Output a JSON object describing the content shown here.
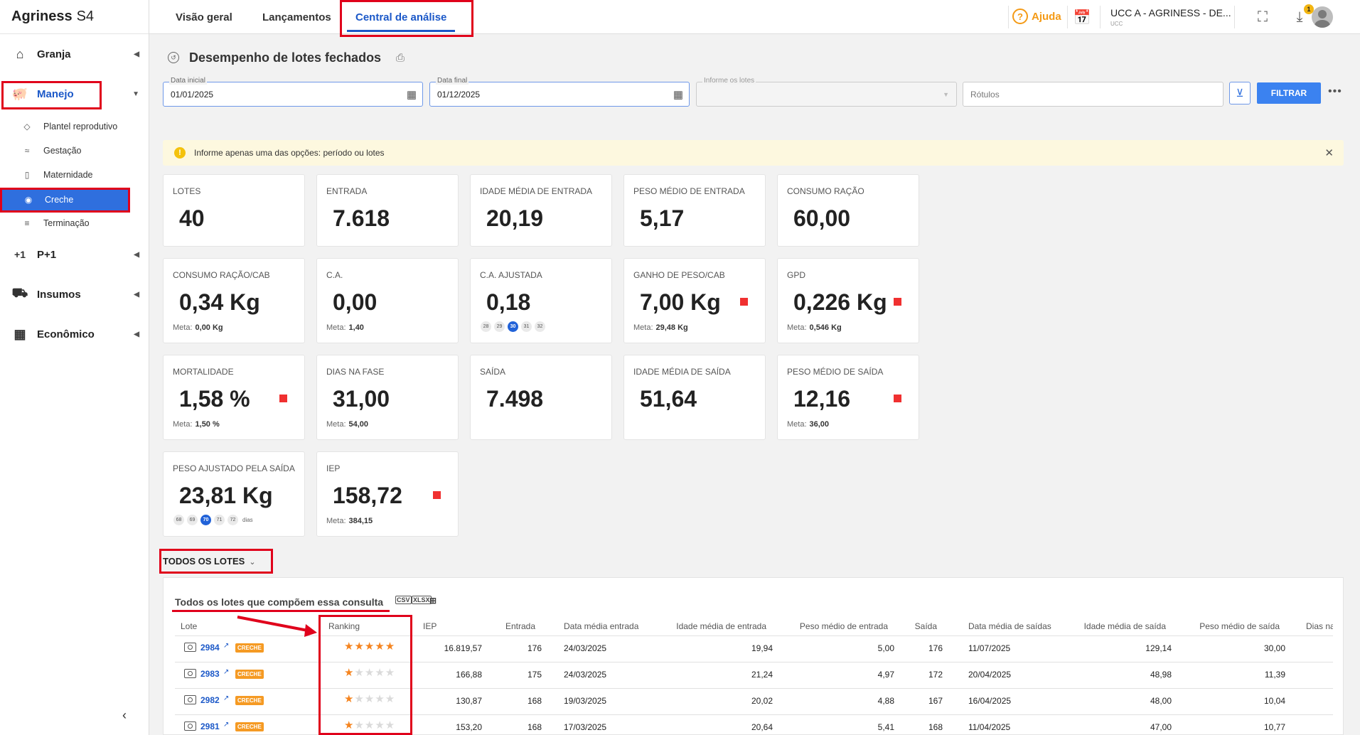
{
  "app": {
    "brand_bold": "Agriness",
    "brand_rest": "S4"
  },
  "tabs": [
    {
      "label": "Visão geral"
    },
    {
      "label": "Lançamentos"
    },
    {
      "label": "Central de análise"
    }
  ],
  "topbar": {
    "help_label": "Ajuda",
    "org_name": "UCC A - AGRINESS - DE...",
    "org_sub": "UCC",
    "notification_count": "1"
  },
  "sidebar": {
    "items": [
      {
        "label": "Granja",
        "icon": "home-icon"
      },
      {
        "label": "Manejo",
        "icon": "pig-icon"
      },
      {
        "label": "P+1",
        "icon": "plus-one-icon"
      },
      {
        "label": "Insumos",
        "icon": "cart-icon"
      },
      {
        "label": "Econômico",
        "icon": "calculator-icon"
      }
    ],
    "sub_items": [
      {
        "label": "Plantel reprodutivo"
      },
      {
        "label": "Gestação"
      },
      {
        "label": "Maternidade"
      },
      {
        "label": "Creche"
      },
      {
        "label": "Terminação"
      }
    ]
  },
  "page": {
    "title": "Desempenho de lotes fechados"
  },
  "filters": {
    "start_label": "Data inicial",
    "start_value": "01/01/2025",
    "end_label": "Data final",
    "end_value": "01/12/2025",
    "lotes_label": "Informe os lotes",
    "rotulos_placeholder": "Rótulos",
    "filter_button": "FILTRAR"
  },
  "alert": {
    "text": "Informe apenas uma das opções: período ou lotes"
  },
  "cards": [
    {
      "label": "Lotes",
      "value": "40"
    },
    {
      "label": "Entrada",
      "value": "7.618"
    },
    {
      "label": "Idade média de entrada",
      "value": "20,19"
    },
    {
      "label": "Peso médio de entrada",
      "value": "5,17"
    },
    {
      "label": "Consumo ração",
      "value": "60,00"
    },
    {
      "label": "Consumo ração/cab",
      "value": "0,34 Kg",
      "meta_label": "Meta:",
      "meta_value": "0,00 Kg"
    },
    {
      "label": "C.A.",
      "value": "0,00",
      "meta_label": "Meta:",
      "meta_value": "1,40"
    },
    {
      "label": "C.A. ajustada",
      "value": "0,18",
      "pills": [
        "28",
        "29",
        "30",
        "31",
        "32"
      ],
      "selected": "30"
    },
    {
      "label": "Ganho de peso/cab",
      "value": "7,00 Kg",
      "meta_label": "Meta:",
      "meta_value": "29,48 Kg"
    },
    {
      "label": "GPD",
      "value": "0,226 Kg",
      "meta_label": "Meta:",
      "meta_value": "0,546 Kg"
    },
    {
      "label": "Mortalidade",
      "value": "1,58 %",
      "meta_label": "Meta:",
      "meta_value": "1,50 %"
    },
    {
      "label": "Dias na fase",
      "value": "31,00",
      "meta_label": "Meta:",
      "meta_value": "54,00"
    },
    {
      "label": "Saída",
      "value": "7.498"
    },
    {
      "label": "Idade média de saída",
      "value": "51,64"
    },
    {
      "label": "Peso médio de saída",
      "value": "12,16",
      "meta_label": "Meta:",
      "meta_value": "36,00"
    },
    {
      "label": "Peso ajustado pela saída",
      "value": "23,81 Kg",
      "pills": [
        "68",
        "69",
        "70",
        "71",
        "72"
      ],
      "selected": "70",
      "pill_unit": "dias"
    },
    {
      "label": "IEP",
      "value": "158,72",
      "meta_label": "Meta:",
      "meta_value": "384,15"
    }
  ],
  "section": {
    "toggle_label": "TODOS OS LOTES",
    "table_title": "Todos os lotes que compõem essa consulta",
    "export": [
      "CSV",
      "XLSX"
    ]
  },
  "table": {
    "headers": [
      "Lote",
      "Ranking",
      "IEP",
      "Entrada",
      "Data média entrada",
      "Idade média de entrada",
      "Peso médio de entrada",
      "Saída",
      "Data média de saídas",
      "Idade média de saída",
      "Peso médio de saída",
      "Dias na"
    ],
    "rows": [
      {
        "lote": "2984",
        "tag": "CRECHE",
        "stars": 5,
        "iep": "16.819,57",
        "entrada": "176",
        "data_entrada": "24/03/2025",
        "idade_entrada": "19,94",
        "peso_entrada": "5,00",
        "saida": "176",
        "data_saida": "11/07/2025",
        "idade_saida": "129,14",
        "peso_saida": "30,00"
      },
      {
        "lote": "2983",
        "tag": "CRECHE",
        "stars": 1,
        "iep": "166,88",
        "entrada": "175",
        "data_entrada": "24/03/2025",
        "idade_entrada": "21,24",
        "peso_entrada": "4,97",
        "saida": "172",
        "data_saida": "20/04/2025",
        "idade_saida": "48,98",
        "peso_saida": "11,39"
      },
      {
        "lote": "2982",
        "tag": "CRECHE",
        "stars": 1,
        "iep": "130,87",
        "entrada": "168",
        "data_entrada": "19/03/2025",
        "idade_entrada": "20,02",
        "peso_entrada": "4,88",
        "saida": "167",
        "data_saida": "16/04/2025",
        "idade_saida": "48,00",
        "peso_saida": "10,04"
      },
      {
        "lote": "2981",
        "tag": "CRECHE",
        "stars": 1,
        "iep": "153,20",
        "entrada": "168",
        "data_entrada": "17/03/2025",
        "idade_entrada": "20,64",
        "peso_entrada": "5,41",
        "saida": "168",
        "data_saida": "11/04/2025",
        "idade_saida": "47,00",
        "peso_saida": "10,77"
      }
    ]
  },
  "colors": {
    "accent": "#1b58c8",
    "highlight": "#e0001b",
    "star": "#f5841f",
    "tag": "#f59a23",
    "flag": "#f03030"
  }
}
